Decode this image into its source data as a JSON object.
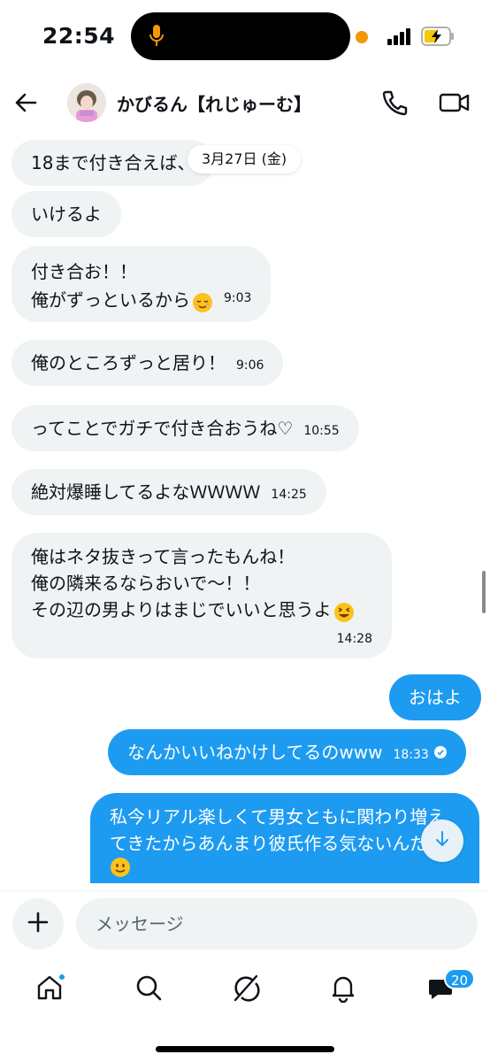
{
  "status_bar": {
    "time": "22:54",
    "icons": [
      "microphone-icon",
      "orange-privacy-dot",
      "signal-icon",
      "battery-charging-icon"
    ],
    "accent": "#f5960a"
  },
  "header": {
    "contact_name": "かびるん【れじゅーむ】",
    "icons": [
      "back-arrow-icon",
      "phone-icon",
      "video-camera-icon"
    ]
  },
  "date_chip": "3月27日 (金)",
  "messages": [
    {
      "dir": "in",
      "text": "18まで付き合えば、",
      "time": ""
    },
    {
      "dir": "in",
      "text": "いけるよ",
      "time": ""
    },
    {
      "dir": "in",
      "lines": [
        "付き合お！！",
        "俺がずっといるから"
      ],
      "emoji": "relieved-face",
      "time": "9:03"
    },
    {
      "dir": "in",
      "text": "俺のところずっと居り！",
      "time": "9:06"
    },
    {
      "dir": "in",
      "text": "ってことでガチで付き合おうね♡",
      "time": "10:55"
    },
    {
      "dir": "in",
      "text": "絶対爆睡してるよなＷＷＷＷ",
      "time": "14:25"
    },
    {
      "dir": "in",
      "lines": [
        "俺はネタ抜きって言ったもんね！",
        "俺の隣来るならおいで〜！！",
        "その辺の男よりはまじでいいと思うよ"
      ],
      "emoji": "grinning-squinting-face",
      "time": "14:28"
    },
    {
      "dir": "out",
      "text": "おはよ",
      "time": ""
    },
    {
      "dir": "out",
      "text": "なんかいいねかけしてるのwww",
      "time": "18:33",
      "read": true
    },
    {
      "dir": "out",
      "lines": [
        "私今リアル楽しくて男女ともに関わり増え",
        "てきたからあんまり彼氏作る気ないんだ"
      ],
      "emoji": "slightly-smiling-face",
      "time": ""
    }
  ],
  "composer": {
    "placeholder": "メッセージ",
    "icons": [
      "plus-icon"
    ]
  },
  "tabbar": {
    "tabs": [
      "home",
      "search",
      "grok",
      "notifications",
      "messages"
    ],
    "messages_badge": "20"
  },
  "colors": {
    "outgoing_bubble": "#1d9bf0",
    "incoming_bubble": "#eff3f4",
    "text": "#0f1419"
  }
}
